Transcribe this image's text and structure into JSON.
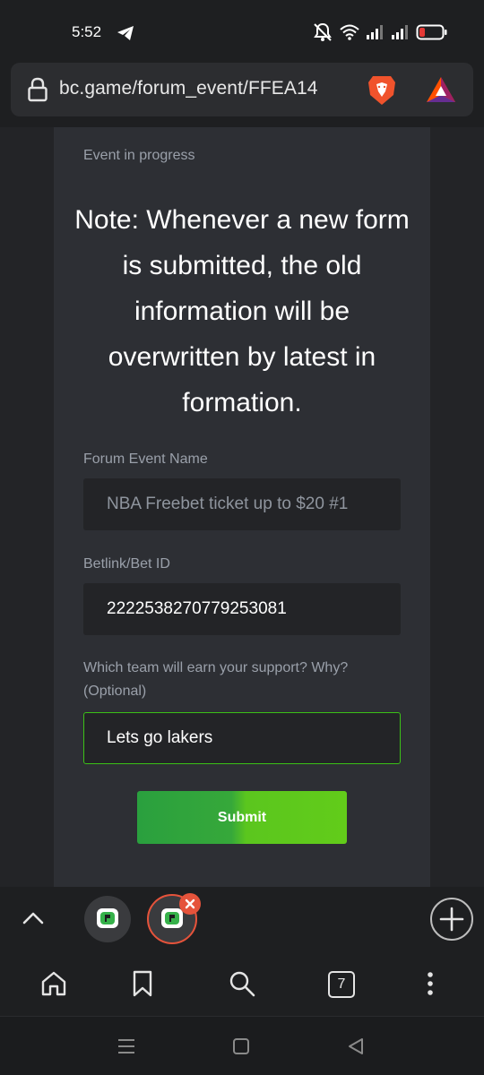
{
  "status_bar": {
    "time": "5:52",
    "icons": [
      "telegram-icon",
      "mute-icon",
      "wifi-icon",
      "signal-icon",
      "signal-icon",
      "battery-icon"
    ]
  },
  "browser": {
    "url": "bc.game/forum_event/FFEA14",
    "icons": [
      "lock-icon",
      "brave-shield-icon",
      "bat-rewards-icon"
    ]
  },
  "page": {
    "event_status": "Event in progress",
    "note": "Note: Whenever a new form is submitted, the old information will be overwritten by latest in formation.",
    "fields": {
      "event_name": {
        "label": "Forum Event Name",
        "placeholder": "NBA Freebet ticket up to $20 #1"
      },
      "betlink": {
        "label": "Betlink/Bet ID",
        "value": "2222538270779253081"
      },
      "team_support": {
        "label": "Which team will earn your support? Why? (Optional)",
        "value": "Lets go lakers"
      }
    },
    "submit_label": "Submit"
  },
  "tabs": {
    "count": "7",
    "open_tabs": [
      "bc-game-tab",
      "bc-game-tab-active"
    ]
  },
  "colors": {
    "accent_green": "#3bc117",
    "tab_active_ring": "#e5533b",
    "card_bg": "#2d2f34",
    "field_bg": "#232427"
  }
}
